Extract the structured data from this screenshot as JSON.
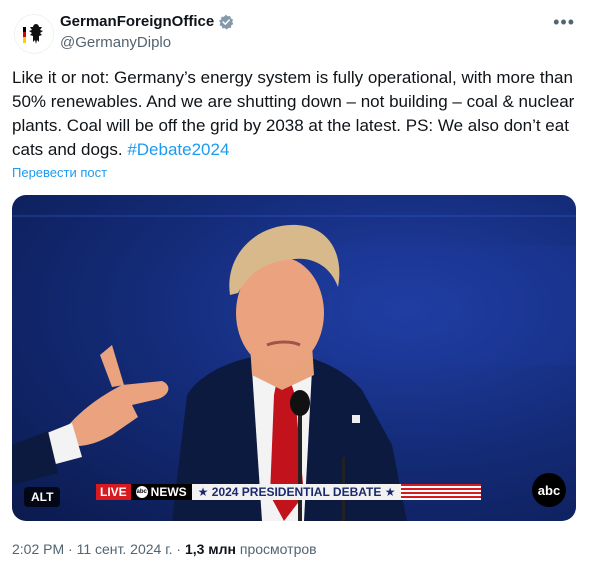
{
  "author": {
    "display_name": "GermanForeignOffice",
    "handle": "@GermanyDiplo"
  },
  "tweet": {
    "text": "Like it or not: Germany’s energy system is fully operational, with more than 50% renewables. And we are shutting down – not building – coal & nuclear plants. Coal will be off the grid by 2038 at the latest. PS: We also don’t eat cats and dogs.",
    "hashtag": "#Debate2024",
    "translate_label": "Перевести пост"
  },
  "media": {
    "alt_label": "ALT",
    "chyron": {
      "live": "LIVE",
      "network": "NEWS",
      "title": "★ 2024 PRESIDENTIAL DEBATE ★"
    },
    "logo_text": "abc"
  },
  "meta": {
    "time": "2:02 PM",
    "separator": "·",
    "date": "11 сент. 2024 г.",
    "views_count": "1,3 млн",
    "views_label": "просмотров"
  },
  "colors": {
    "accent": "#1d9bf0",
    "text": "#0f1419",
    "muted": "#536471",
    "verified": "#829aab"
  }
}
